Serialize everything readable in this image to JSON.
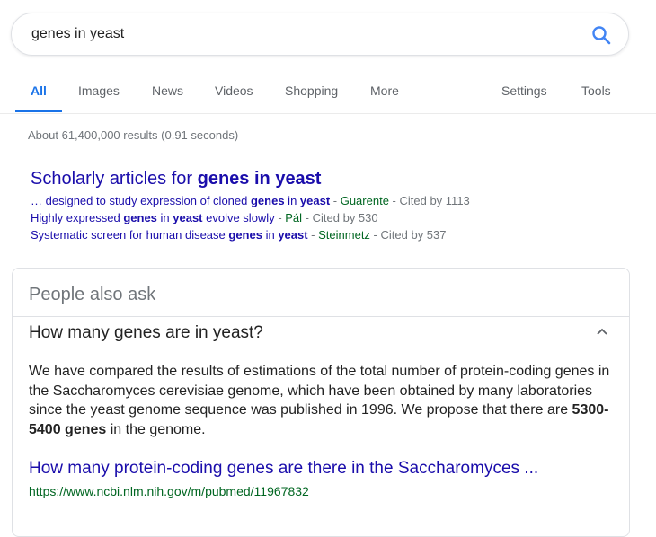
{
  "search": {
    "query": "genes in yeast"
  },
  "tabs": [
    "All",
    "Images",
    "News",
    "Videos",
    "Shopping",
    "More"
  ],
  "tools": {
    "settings": "Settings",
    "tools": "Tools"
  },
  "result_stats": "About 61,400,000 results (0.91 seconds)",
  "scholarly": {
    "title_prefix": "Scholarly articles for ",
    "title_bold": "genes in yeast",
    "items": [
      {
        "pre": "… designed to study expression of cloned ",
        "b1": "genes",
        "mid": " in ",
        "b2": "yeast",
        "post": "",
        "author": "Guarente",
        "cited": "Cited by 1113"
      },
      {
        "pre": "Highly expressed ",
        "b1": "genes",
        "mid": " in ",
        "b2": "yeast",
        "post": " evolve slowly",
        "author": "Pál",
        "cited": "Cited by 530"
      },
      {
        "pre": "Systematic screen for human disease ",
        "b1": "genes",
        "mid": " in ",
        "b2": "yeast",
        "post": "",
        "author": "Steinmetz",
        "cited": "Cited by 537"
      }
    ]
  },
  "paa": {
    "title": "People also ask",
    "question": "How many genes are in yeast?",
    "answer_pre": "We have compared the results of estimations of the total number of protein-coding genes in the Saccharomyces cerevisiae genome, which have been obtained by many laboratories since the yeast genome sequence was published in 1996. We propose that there are ",
    "answer_bold": "5300-5400 genes",
    "answer_post": " in the genome.",
    "link_title": "How many protein-coding genes are there in the Saccharomyces ...",
    "link_url": "https://www.ncbi.nlm.nih.gov/m/pubmed/11967832"
  },
  "colors": {
    "accent": "#1a73e8",
    "link": "#1a0dab",
    "url": "#006621",
    "muted": "#70757a"
  },
  "icons": {
    "search": "search-icon",
    "chevron": "chevron-up-icon"
  }
}
